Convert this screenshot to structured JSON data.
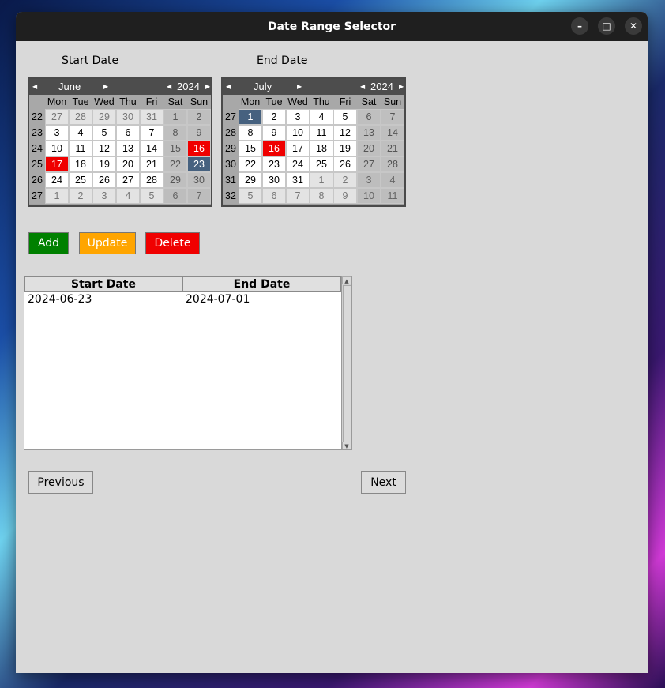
{
  "window": {
    "title": "Date Range Selector",
    "minimize": "–",
    "maximize": "□",
    "close": "✕"
  },
  "labels": {
    "start": "Start Date",
    "end": "End Date"
  },
  "start_cal": {
    "month": "June",
    "year": "2024",
    "day_headers": [
      "Mon",
      "Tue",
      "Wed",
      "Thu",
      "Fri",
      "Sat",
      "Sun"
    ],
    "weeks": [
      {
        "wk": "22",
        "days": [
          [
            "27",
            "om"
          ],
          [
            "28",
            "om"
          ],
          [
            "29",
            "om"
          ],
          [
            "30",
            "om"
          ],
          [
            "31",
            "om"
          ],
          [
            "1",
            "we"
          ],
          [
            "2",
            "we"
          ]
        ]
      },
      {
        "wk": "23",
        "days": [
          [
            "3",
            ""
          ],
          [
            "4",
            ""
          ],
          [
            "5",
            ""
          ],
          [
            "6",
            ""
          ],
          [
            "7",
            ""
          ],
          [
            "8",
            "we"
          ],
          [
            "9",
            "we"
          ]
        ]
      },
      {
        "wk": "24",
        "days": [
          [
            "10",
            ""
          ],
          [
            "11",
            ""
          ],
          [
            "12",
            ""
          ],
          [
            "13",
            ""
          ],
          [
            "14",
            ""
          ],
          [
            "15",
            "we"
          ],
          [
            "16",
            "red"
          ]
        ]
      },
      {
        "wk": "25",
        "days": [
          [
            "17",
            "red"
          ],
          [
            "18",
            ""
          ],
          [
            "19",
            ""
          ],
          [
            "20",
            ""
          ],
          [
            "21",
            ""
          ],
          [
            "22",
            "we"
          ],
          [
            "23",
            "sel"
          ]
        ]
      },
      {
        "wk": "26",
        "days": [
          [
            "24",
            ""
          ],
          [
            "25",
            ""
          ],
          [
            "26",
            ""
          ],
          [
            "27",
            ""
          ],
          [
            "28",
            ""
          ],
          [
            "29",
            "we"
          ],
          [
            "30",
            "we"
          ]
        ]
      },
      {
        "wk": "27",
        "days": [
          [
            "1",
            "om"
          ],
          [
            "2",
            "om"
          ],
          [
            "3",
            "om"
          ],
          [
            "4",
            "om"
          ],
          [
            "5",
            "om"
          ],
          [
            "6",
            "om we"
          ],
          [
            "7",
            "om we"
          ]
        ]
      }
    ]
  },
  "end_cal": {
    "month": "July",
    "year": "2024",
    "day_headers": [
      "Mon",
      "Tue",
      "Wed",
      "Thu",
      "Fri",
      "Sat",
      "Sun"
    ],
    "weeks": [
      {
        "wk": "27",
        "days": [
          [
            "1",
            "sel"
          ],
          [
            "2",
            ""
          ],
          [
            "3",
            ""
          ],
          [
            "4",
            ""
          ],
          [
            "5",
            ""
          ],
          [
            "6",
            "we"
          ],
          [
            "7",
            "we"
          ]
        ]
      },
      {
        "wk": "28",
        "days": [
          [
            "8",
            ""
          ],
          [
            "9",
            ""
          ],
          [
            "10",
            ""
          ],
          [
            "11",
            ""
          ],
          [
            "12",
            ""
          ],
          [
            "13",
            "we"
          ],
          [
            "14",
            "we"
          ]
        ]
      },
      {
        "wk": "29",
        "days": [
          [
            "15",
            ""
          ],
          [
            "16",
            "red"
          ],
          [
            "17",
            ""
          ],
          [
            "18",
            ""
          ],
          [
            "19",
            ""
          ],
          [
            "20",
            "we"
          ],
          [
            "21",
            "we"
          ]
        ]
      },
      {
        "wk": "30",
        "days": [
          [
            "22",
            ""
          ],
          [
            "23",
            ""
          ],
          [
            "24",
            ""
          ],
          [
            "25",
            ""
          ],
          [
            "26",
            ""
          ],
          [
            "27",
            "we"
          ],
          [
            "28",
            "we"
          ]
        ]
      },
      {
        "wk": "31",
        "days": [
          [
            "29",
            ""
          ],
          [
            "30",
            ""
          ],
          [
            "31",
            ""
          ],
          [
            "1",
            "om"
          ],
          [
            "2",
            "om"
          ],
          [
            "3",
            "om we"
          ],
          [
            "4",
            "om we"
          ]
        ]
      },
      {
        "wk": "32",
        "days": [
          [
            "5",
            "om"
          ],
          [
            "6",
            "om"
          ],
          [
            "7",
            "om"
          ],
          [
            "8",
            "om"
          ],
          [
            "9",
            "om"
          ],
          [
            "10",
            "om we"
          ],
          [
            "11",
            "om we"
          ]
        ]
      }
    ]
  },
  "buttons": {
    "add": "Add",
    "update": "Update",
    "delete": "Delete",
    "previous": "Previous",
    "next": "Next"
  },
  "table": {
    "headers": [
      "Start Date",
      "End Date"
    ],
    "rows": [
      [
        "2024-06-23",
        "2024-07-01"
      ]
    ]
  }
}
